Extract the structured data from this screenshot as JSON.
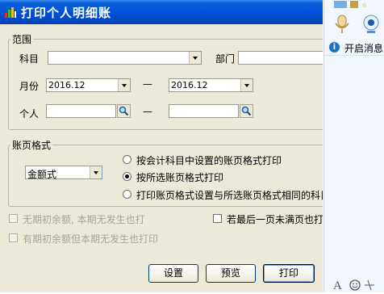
{
  "dialog": {
    "title": "打印个人明细账"
  },
  "range": {
    "legend": "范围",
    "subject_label": "科目",
    "subject_value": "",
    "dept_label": "部门",
    "month_label": "月份",
    "month_from": "2016.12",
    "month_to": "2016.12",
    "dash1": "—",
    "person_label": "个人",
    "dash2": "—"
  },
  "format": {
    "legend": "账页格式",
    "type_value": "金额式",
    "options": [
      "按会计科目中设置的账页格式打印",
      "按所选账页格式打印",
      "打印账页格式设置与所选账页格式相同的科目"
    ],
    "selected_index": 1
  },
  "checks": {
    "no_open_no_occur": "无期初余额, 本期无发生也打",
    "has_open_no_occur": "有期初余额但本期无发生也打印",
    "last_page_partial": "若最后一页未满页也打"
  },
  "buttons": {
    "settings": "设置",
    "preview": "预览",
    "print": "打印"
  },
  "side": {
    "notice": "开启消息"
  },
  "colors": {
    "title_bar": "#0052d6",
    "dialog_bg": "#ece9d8",
    "side_bg": "#f1f7fc",
    "info_blue": "#1a73c9"
  }
}
